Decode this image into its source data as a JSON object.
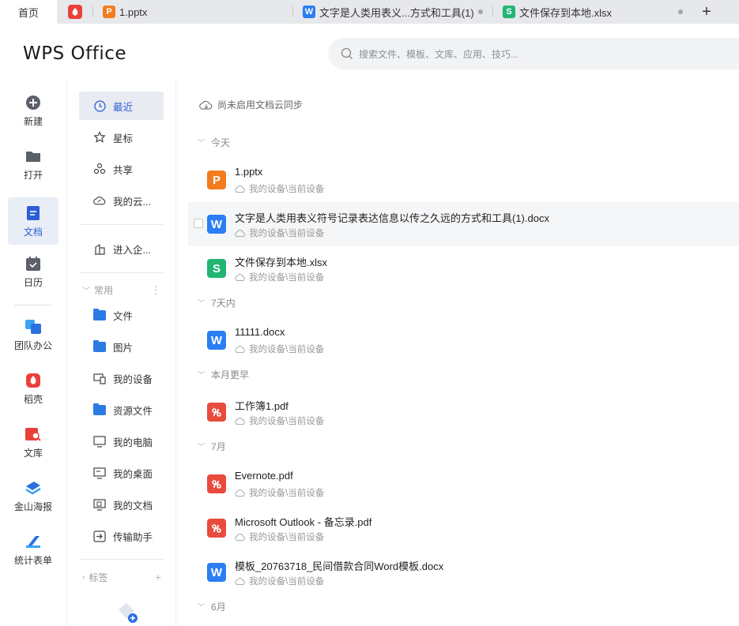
{
  "tabs": [
    {
      "label": "首页",
      "type": "home"
    },
    {
      "label": "",
      "type": "daoke",
      "color": "#e8413a"
    },
    {
      "label": "1.pptx",
      "type": "pptx",
      "icon_letter": "P",
      "color": "#f27c1f"
    },
    {
      "label": "文字是人类用表义...方式和工具(1)",
      "type": "docx",
      "icon_letter": "W",
      "color": "#2b7ef3"
    },
    {
      "label": "文件保存到本地.xlsx",
      "type": "xlsx",
      "icon_letter": "S",
      "color": "#22b573"
    }
  ],
  "add_tab": "+",
  "header": {
    "logo": "WPS Office",
    "search_placeholder": "搜索文件、模板、文库、应用、技巧..."
  },
  "leftbar": [
    {
      "label": "新建",
      "icon": "plus-circle-icon"
    },
    {
      "label": "打开",
      "icon": "folder-icon"
    },
    {
      "label": "文档",
      "icon": "document-icon",
      "active": true
    },
    {
      "label": "日历",
      "icon": "calendar-icon"
    },
    {
      "label": "团队办公",
      "icon": "team-icon"
    },
    {
      "label": "稻壳",
      "icon": "daoke-icon"
    },
    {
      "label": "文库",
      "icon": "library-icon"
    },
    {
      "label": "金山海报",
      "icon": "poster-icon"
    },
    {
      "label": "统计表单",
      "icon": "form-icon"
    }
  ],
  "nav": {
    "items": [
      {
        "label": "最近",
        "icon": "clock-icon",
        "active": true
      },
      {
        "label": "星标",
        "icon": "star-icon"
      },
      {
        "label": "共享",
        "icon": "share-icon"
      },
      {
        "label": "我的云...",
        "icon": "cloud-icon"
      },
      {
        "label": "进入企...",
        "icon": "enterprise-icon"
      }
    ],
    "common_header": "常用",
    "common": [
      {
        "label": "文件",
        "icon": "folder-icon"
      },
      {
        "label": "图片",
        "icon": "folder-icon"
      },
      {
        "label": "我的设备",
        "icon": "device-icon"
      },
      {
        "label": "资源文件",
        "icon": "folder-icon"
      },
      {
        "label": "我的电脑",
        "icon": "computer-icon"
      },
      {
        "label": "我的桌面",
        "icon": "desktop-icon"
      },
      {
        "label": "我的文档",
        "icon": "documents-icon"
      },
      {
        "label": "传输助手",
        "icon": "transfer-icon"
      }
    ],
    "tags_header": "标签",
    "tags_add": "+"
  },
  "main": {
    "sync_notice": "尚未启用文档云同步",
    "groups": [
      {
        "label": "今天",
        "files": [
          {
            "name": "1.pptx",
            "type": "P",
            "location": "我的设备\\当前设备"
          },
          {
            "name": "文字是人类用表义符号记录表达信息以传之久远的方式和工具(1).docx",
            "type": "W",
            "location": "我的设备\\当前设备",
            "hover": true
          },
          {
            "name": "文件保存到本地.xlsx",
            "type": "S",
            "location": "我的设备\\当前设备"
          }
        ]
      },
      {
        "label": "7天内",
        "files": [
          {
            "name": "11111.docx",
            "type": "W",
            "location": "我的设备\\当前设备"
          }
        ]
      },
      {
        "label": "本月更早",
        "files": [
          {
            "name": "工作簿1.pdf",
            "type": "PDF",
            "location": "我的设备\\当前设备"
          }
        ]
      },
      {
        "label": "7月",
        "files": [
          {
            "name": "Evernote.pdf",
            "type": "PDF",
            "location": "我的设备\\当前设备"
          },
          {
            "name": "Microsoft Outlook - 备忘录.pdf",
            "type": "PDF",
            "location": "我的设备\\当前设备"
          },
          {
            "name": "模板_20763718_民间借款合同Word模板.docx",
            "type": "W",
            "location": "我的设备\\当前设备"
          }
        ]
      },
      {
        "label": "6月",
        "files": []
      }
    ]
  }
}
